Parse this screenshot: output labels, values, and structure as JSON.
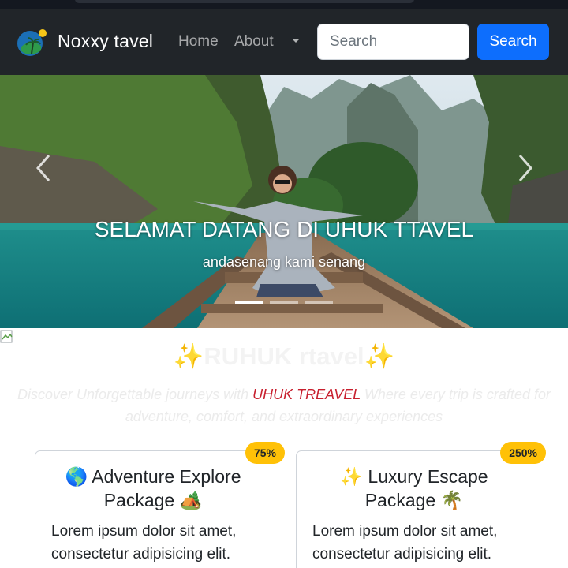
{
  "navbar": {
    "brand_name": "Noxxy tavel",
    "links": [
      {
        "label": "Home"
      },
      {
        "label": "About"
      }
    ],
    "search": {
      "placeholder": "Search",
      "button_label": "Search"
    }
  },
  "hero": {
    "title": "SELAMAT DATANG DI UHUK TTAVEL",
    "subtitle": "andasenang kami senang",
    "slide_count": 3,
    "active_slide": 1
  },
  "section": {
    "title_icon": "✨",
    "title_text": "RUHUK rtavel",
    "description_pre": "Discover Unforgettable journeys with ",
    "description_brand": "UHUK TREAVEL",
    "description_post": " Where every trip is crafted for adventure, comfort, and extraordinary experiences"
  },
  "cards": [
    {
      "badge": "75%",
      "title_line1": "🌎 Adventure Explore",
      "title_line2": "Package 🏕️",
      "text": "Lorem ipsum dolor sit amet, consectetur adipisicing elit."
    },
    {
      "badge": "250%",
      "title_line1": "✨ Luxury Escape",
      "title_line2": "Package 🌴",
      "text": "Lorem ipsum dolor sit amet, consectetur adipisicing elit."
    }
  ],
  "colors": {
    "navbar_bg": "#212529",
    "primary": "#0d6efd",
    "badge": "#ffc107",
    "brand_accent": "#c8202f"
  },
  "icons": {
    "logo": "travel-globe-palm-logo",
    "dropdown": "caret-down-icon",
    "prev": "chevron-left-icon",
    "next": "chevron-right-icon"
  }
}
